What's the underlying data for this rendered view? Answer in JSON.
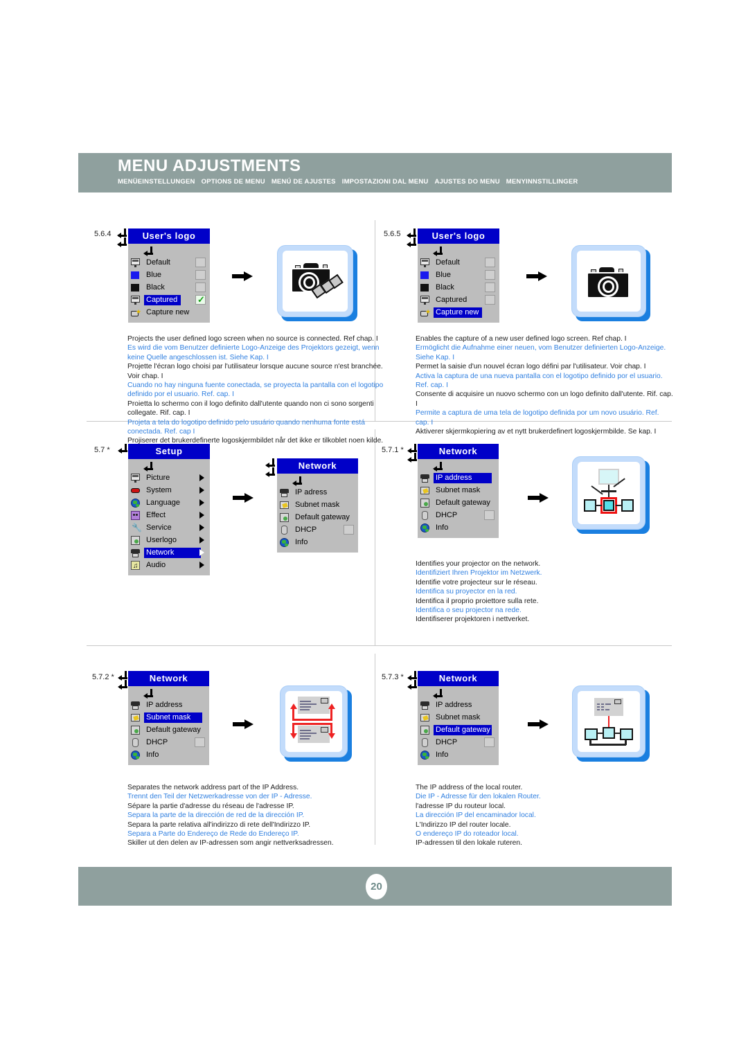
{
  "header": {
    "title": "MENU ADJUSTMENTS",
    "subtitles": [
      "MENÜEINSTELLUNGEN",
      "OPTIONS DE MENU",
      "MENÚ DE AJUSTES",
      "IMPOSTAZIONI DAL MENU",
      "AJUSTES DO MENU",
      "MENYINNSTILLINGER"
    ]
  },
  "footer": {
    "page_number": "20"
  },
  "colors": {
    "band": "#8fa09e",
    "osd_title_blue": "#0000c8",
    "osd_body_gray": "#bdbdbd",
    "link_blue": "#2f7fe0",
    "card_border": "#c3dcfb",
    "card_shadow": "#1a7fe0",
    "red_accent": "#ee2222"
  },
  "sections": [
    {
      "number": "5.6.4",
      "menu": {
        "title": "User's logo",
        "items": [
          {
            "label": "Default",
            "icon": "logo-screen-icon",
            "selected": false,
            "checkbox": "empty"
          },
          {
            "label": "Blue",
            "icon": "blue-square-icon",
            "selected": false,
            "checkbox": "empty"
          },
          {
            "label": "Black",
            "icon": "black-square-icon",
            "selected": false,
            "checkbox": "empty"
          },
          {
            "label": "Captured",
            "icon": "logo-screen-icon",
            "selected": true,
            "checkbox": "checked"
          },
          {
            "label": "Capture new",
            "icon": "capture-icon",
            "selected": false,
            "checkbox": "none"
          }
        ]
      },
      "illustration": "camera-with-film-icon",
      "desc": {
        "en": "Projects the user defined logo screen when no source is connected. Ref chap. I",
        "de": "Es wird die vom Benutzer definierte Logo-Anzeige des Projektors gezeigt, wenn keine Quelle angeschlossen ist. Siehe Kap. I",
        "fr": "Projette l'écran logo choisi par l'utilisateur lorsque aucune source n'est branchée. Voir chap. I",
        "es": "Cuando no hay ninguna fuente conectada, se proyecta la pantalla con el logotipo definido por el usuario. Ref. cap. I",
        "it": "Proietta lo schermo con il logo definito dall'utente quando non ci sono sorgenti collegate. Rif. cap. I",
        "pt": "Projeta a tela do logotipo definido pelo usuário quando nenhuma fonte está conectada. Ref. cap I",
        "no": "Projiserer det brukerdefinerte logoskjermbildet når det ikke er tilkoblet noen kilde. Se kap. I"
      }
    },
    {
      "number": "5.6.5",
      "menu": {
        "title": "User's logo",
        "items": [
          {
            "label": "Default",
            "icon": "logo-screen-icon",
            "selected": false,
            "checkbox": "empty"
          },
          {
            "label": "Blue",
            "icon": "blue-square-icon",
            "selected": false,
            "checkbox": "empty"
          },
          {
            "label": "Black",
            "icon": "black-square-icon",
            "selected": false,
            "checkbox": "empty"
          },
          {
            "label": "Captured",
            "icon": "logo-screen-icon",
            "selected": false,
            "checkbox": "empty"
          },
          {
            "label": "Capture new",
            "icon": "capture-icon",
            "selected": true,
            "checkbox": "none"
          }
        ]
      },
      "illustration": "camera-icon",
      "desc": {
        "en": "Enables the capture of a new user defined logo screen. Ref chap. I",
        "de": "Ermöglicht die Aufnahme einer neuen, vom Benutzer definierten Logo-Anzeige. Siehe Kap. I",
        "fr": "Permet la saisie d'un nouvel écran logo défini par l'utilisateur. Voir chap. I",
        "es": "Activa la captura de una nueva pantalla con el logotipo definido por el usuario. Ref. cap. I",
        "it": "Consente di acquisire un nuovo schermo con un logo definito dall'utente. Rif. cap. I",
        "pt": "Permite a captura de uma tela de logotipo definida por um novo usuário. Ref. cap. I",
        "no": "Aktiverer skjermkopiering av et nytt brukerdefinert logoskjermbilde. Se kap. I"
      }
    },
    {
      "number": "5.7 *",
      "menu": {
        "title": "Setup",
        "items": [
          {
            "label": "Picture",
            "icon": "picture-icon",
            "selected": false,
            "submenu": true
          },
          {
            "label": "System",
            "icon": "system-icon",
            "selected": false,
            "submenu": true
          },
          {
            "label": "Language",
            "icon": "language-icon",
            "selected": false,
            "submenu": true
          },
          {
            "label": "Effect",
            "icon": "effect-icon",
            "selected": false,
            "submenu": true
          },
          {
            "label": "Service",
            "icon": "wrench-icon",
            "selected": false,
            "submenu": true
          },
          {
            "label": "Userlogo",
            "icon": "userlogo-icon",
            "selected": false,
            "submenu": true
          },
          {
            "label": "Network",
            "icon": "network-icon",
            "selected": true,
            "submenu": true
          },
          {
            "label": "Audio",
            "icon": "audio-icon",
            "selected": false,
            "submenu": true
          }
        ]
      },
      "menu2": {
        "title": "Network",
        "items": [
          {
            "label": "IP adress",
            "icon": "ip-address-icon",
            "selected": false,
            "checkbox": "none"
          },
          {
            "label": "Subnet mask",
            "icon": "subnet-mask-icon",
            "selected": false,
            "checkbox": "none"
          },
          {
            "label": "Default gateway",
            "icon": "default-gateway-icon",
            "selected": false,
            "checkbox": "none"
          },
          {
            "label": "DHCP",
            "icon": "dhcp-icon",
            "selected": false,
            "checkbox": "empty"
          },
          {
            "label": "Info",
            "icon": "info-globe-icon",
            "selected": false,
            "checkbox": "none"
          }
        ]
      },
      "desc": null
    },
    {
      "number": "5.7.1 *",
      "menu": {
        "title": "Network",
        "items": [
          {
            "label": "IP address",
            "icon": "ip-address-icon",
            "selected": true,
            "checkbox": "none"
          },
          {
            "label": "Subnet mask",
            "icon": "subnet-mask-icon",
            "selected": false,
            "checkbox": "none"
          },
          {
            "label": "Default gateway",
            "icon": "default-gateway-icon",
            "selected": false,
            "checkbox": "none"
          },
          {
            "label": "DHCP",
            "icon": "dhcp-icon",
            "selected": false,
            "checkbox": "empty"
          },
          {
            "label": "Info",
            "icon": "info-globe-icon",
            "selected": false,
            "checkbox": "none"
          }
        ]
      },
      "illustration": "network-topology-icon",
      "desc": {
        "en": "Identifies your projector on the network.",
        "de": "Identifiziert Ihren Projektor im Netzwerk.",
        "fr": "Identifie votre projecteur sur le réseau.",
        "es": "Identifica su proyector en la red.",
        "it": "Identifica il proprio proiettore sulla rete.",
        "pt": "Identifica o seu projector na rede.",
        "no": "Identifiserer projektoren i nettverket."
      }
    },
    {
      "number": "5.7.2 *",
      "menu": {
        "title": "Network",
        "items": [
          {
            "label": "IP address",
            "icon": "ip-address-icon",
            "selected": false,
            "checkbox": "none"
          },
          {
            "label": "Subnet mask",
            "icon": "subnet-mask-icon",
            "selected": true,
            "checkbox": "none"
          },
          {
            "label": "Default gateway",
            "icon": "default-gateway-icon",
            "selected": false,
            "checkbox": "none"
          },
          {
            "label": "DHCP",
            "icon": "dhcp-icon",
            "selected": false,
            "checkbox": "empty"
          },
          {
            "label": "Info",
            "icon": "info-globe-icon",
            "selected": false,
            "checkbox": "none"
          }
        ]
      },
      "illustration": "subnet-split-icon",
      "desc": {
        "en": "Separates the network address part of the IP Address.",
        "de": "Trennt den Teil der Netzwerkadresse von der IP - Adresse.",
        "fr": "Sépare la partie d'adresse du réseau de l'adresse IP.",
        "es": "Separa la parte de la dirección de red de la dirección IP.",
        "it": "Separa la parte relativa all'indirizzo di rete dell'Indirizzo IP.",
        "pt": "Separa a Parte do Endereço de Rede do Endereço IP.",
        "no": "Skiller ut den delen av IP-adressen som angir nettverksadressen."
      }
    },
    {
      "number": "5.7.3 *",
      "menu": {
        "title": "Network",
        "items": [
          {
            "label": "IP address",
            "icon": "ip-address-icon",
            "selected": false,
            "checkbox": "none"
          },
          {
            "label": "Subnet mask",
            "icon": "subnet-mask-icon",
            "selected": false,
            "checkbox": "none"
          },
          {
            "label": "Default gateway",
            "icon": "default-gateway-icon",
            "selected": true,
            "checkbox": "none"
          },
          {
            "label": "DHCP",
            "icon": "dhcp-icon",
            "selected": false,
            "checkbox": "empty"
          },
          {
            "label": "Info",
            "icon": "info-globe-icon",
            "selected": false,
            "checkbox": "none"
          }
        ]
      },
      "illustration": "gateway-router-icon",
      "desc": {
        "en": "The IP address of the local router.",
        "de": "Die IP - Adresse für den lokalen Router.",
        "fr": "l'adresse IP du routeur local.",
        "es": "La dirección IP del encaminador local.",
        "it": "L'Indirizzo IP del router locale.",
        "pt": "O endereço IP do roteador local.",
        "no": "IP-adressen til den lokale ruteren."
      }
    }
  ]
}
